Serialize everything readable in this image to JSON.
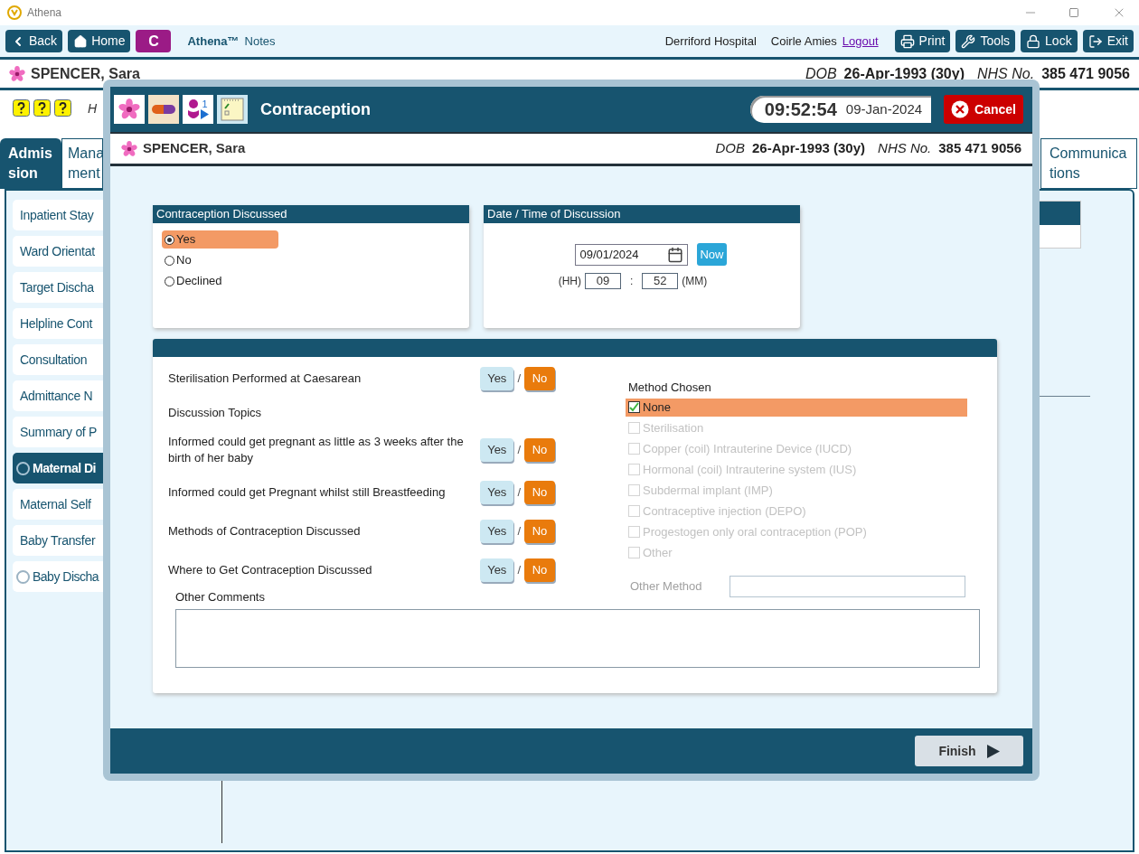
{
  "window": {
    "title": "Athena"
  },
  "toolbar": {
    "nav": [
      {
        "label": "Back",
        "kind": "back"
      },
      {
        "label": "Home",
        "kind": "home"
      }
    ],
    "badge": "C",
    "app_name": "Athena™",
    "app_section": "Notes",
    "hospital": "Derriford Hospital",
    "user": "Coirle Amies",
    "logout": "Logout",
    "actions": [
      {
        "label": "Print",
        "kind": "print"
      },
      {
        "label": "Tools",
        "kind": "tools"
      },
      {
        "label": "Lock",
        "kind": "lock"
      },
      {
        "label": "Exit",
        "kind": "exit"
      }
    ]
  },
  "patient": {
    "name": "SPENCER, Sara",
    "dob_label": "DOB",
    "dob": "26-Apr-1993 (30y)",
    "nhs_label": "NHS No.",
    "nhs": "385 471 9056"
  },
  "background": {
    "hint": "H",
    "tabs": [
      {
        "label_lines": [
          "Admis",
          "sion"
        ],
        "selected": true
      },
      {
        "label_lines": [
          "Mana",
          "ment"
        ],
        "selected": false
      },
      {
        "label_lines": [
          "Communica",
          "tions"
        ],
        "selected": false
      }
    ],
    "sidebar": {
      "items": [
        {
          "label": "Inpatient Stay",
          "kind": "plain",
          "selected": false
        },
        {
          "label": "Ward Orientat",
          "kind": "plain",
          "selected": false
        },
        {
          "label": "Target Discha",
          "kind": "plain",
          "selected": false
        },
        {
          "label": "Helpline Cont",
          "kind": "plain",
          "selected": false
        },
        {
          "label": "Consultation",
          "kind": "plain",
          "selected": false
        },
        {
          "label": "Admittance N",
          "kind": "plain",
          "selected": false
        },
        {
          "label": "Summary of P",
          "kind": "plain",
          "selected": false
        },
        {
          "label": "Maternal Di",
          "kind": "radio",
          "selected": true
        },
        {
          "label": "Maternal Self",
          "kind": "plain",
          "selected": false
        },
        {
          "label": "Baby Transfer",
          "kind": "plain",
          "selected": false
        },
        {
          "label": "Baby Discha",
          "kind": "radio",
          "selected": false
        }
      ]
    }
  },
  "modal": {
    "title": "Contraception",
    "icon_badge": "1",
    "time": "09:52:54",
    "date": "09-Jan-2024",
    "cancel": "Cancel",
    "patient": {
      "name": "SPENCER, Sara",
      "dob_label": "DOB",
      "dob": "26-Apr-1993 (30y)",
      "nhs_label": "NHS No.",
      "nhs": "385 471 9056"
    },
    "discussed": {
      "title": "Contraception Discussed",
      "options": [
        {
          "label": "Yes",
          "selected": true
        },
        {
          "label": "No",
          "selected": false
        },
        {
          "label": "Declined",
          "selected": false
        }
      ]
    },
    "discussion_time": {
      "title": "Date / Time of Discussion",
      "date": "09/01/2024",
      "now": "Now",
      "hh_label": "(HH)",
      "hour": "09",
      "separator": ":",
      "minute": "52",
      "mm_label": "(MM)"
    },
    "questions": [
      {
        "kind": "question",
        "label": "Sterilisation Performed at Caesarean",
        "separator": "/",
        "options": [
          {
            "label": "Yes",
            "selected": false
          },
          {
            "label": "No",
            "selected": true
          }
        ]
      },
      {
        "kind": "heading",
        "label": "Discussion Topics"
      },
      {
        "kind": "question",
        "label": "Informed could get pregnant as little as 3 weeks after the birth of her baby",
        "separator": "/",
        "options": [
          {
            "label": "Yes",
            "selected": false
          },
          {
            "label": "No",
            "selected": true
          }
        ]
      },
      {
        "kind": "question",
        "label": "Informed could get Pregnant whilst still Breastfeeding",
        "separator": "/",
        "options": [
          {
            "label": "Yes",
            "selected": false
          },
          {
            "label": "No",
            "selected": true
          }
        ]
      },
      {
        "kind": "question",
        "label": "Methods of Contraception Discussed",
        "separator": "/",
        "options": [
          {
            "label": "Yes",
            "selected": false
          },
          {
            "label": "No",
            "selected": true
          }
        ]
      },
      {
        "kind": "question",
        "label": "Where to Get Contraception Discussed",
        "separator": "/",
        "options": [
          {
            "label": "Yes",
            "selected": false
          },
          {
            "label": "No",
            "selected": true
          }
        ]
      }
    ],
    "method_chosen": {
      "title": "Method Chosen",
      "options": [
        {
          "label": "None",
          "checked": true,
          "disabled": false
        },
        {
          "label": "Sterilisation",
          "checked": false,
          "disabled": true
        },
        {
          "label": "Copper (coil) Intrauterine Device (IUCD)",
          "checked": false,
          "disabled": true
        },
        {
          "label": "Hormonal (coil) Intrauterine system (IUS)",
          "checked": false,
          "disabled": true
        },
        {
          "label": "Subdermal implant (IMP)",
          "checked": false,
          "disabled": true
        },
        {
          "label": "Contraceptive injection (DEPO)",
          "checked": false,
          "disabled": true
        },
        {
          "label": "Progestogen only oral contraception (POP)",
          "checked": false,
          "disabled": true
        },
        {
          "label": "Other",
          "checked": false,
          "disabled": true
        }
      ],
      "other_method": {
        "label": "Other Method",
        "disabled": true
      }
    },
    "other_comments": {
      "label": "Other Comments"
    },
    "finish": "Finish"
  }
}
